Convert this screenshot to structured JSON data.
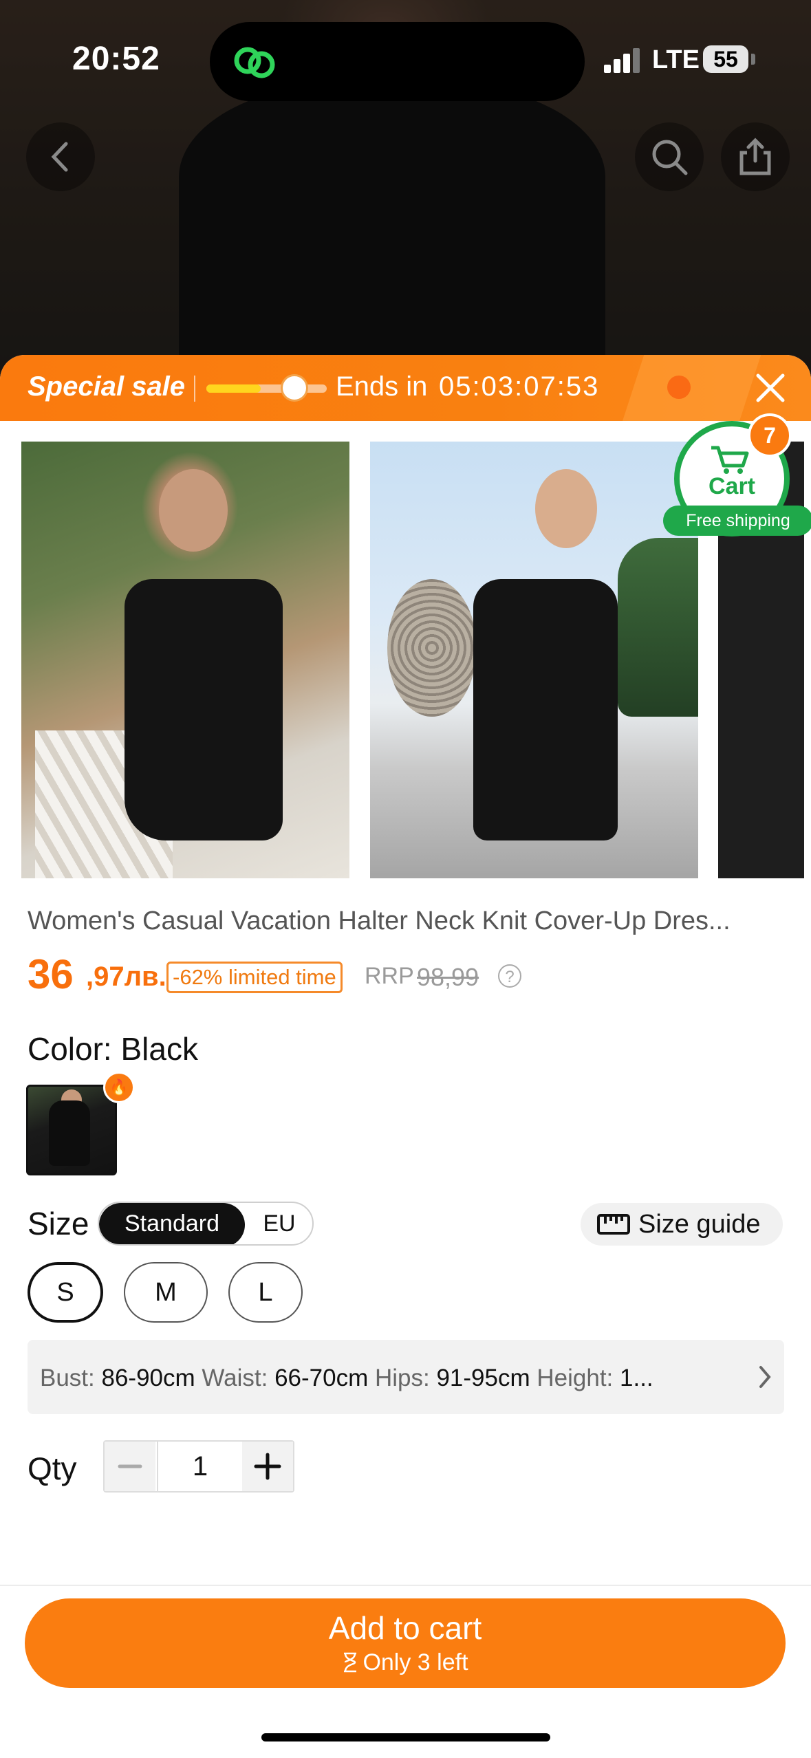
{
  "status": {
    "time": "20:52",
    "network": "LTE",
    "battery": "55"
  },
  "sale": {
    "title": "Special sale",
    "ends_label": "Ends in",
    "countdown": "05:03:07:53",
    "progress": 0.45
  },
  "cart": {
    "label": "Cart",
    "badge": "7",
    "free_shipping": "Free shipping"
  },
  "product": {
    "title": "Women's Casual Vacation Halter Neck Knit Cover-Up Dres...",
    "price_int": "36",
    "price_dec": ",97лв.",
    "discount": "-62% limited time",
    "rrp_label": "RRP",
    "rrp_price": "98,99",
    "help": "?"
  },
  "color": {
    "label": "Color: Black"
  },
  "size": {
    "label": "Size",
    "standard": "Standard",
    "eu": "EU",
    "guide": "Size guide",
    "options": [
      "S",
      "M",
      "L"
    ],
    "selected": "S"
  },
  "measurements": {
    "bust_label": "Bust:",
    "bust": "86-90cm",
    "waist_label": "Waist:",
    "waist": "66-70cm",
    "hips_label": "Hips:",
    "hips": "91-95cm",
    "height_label": "Height:",
    "height": "1..."
  },
  "qty": {
    "label": "Qty",
    "value": "1",
    "minus": "−",
    "plus": "+"
  },
  "cta": {
    "main": "Add to cart",
    "sub": "Only 3 left"
  },
  "icons": {
    "back": "chevron-left-icon",
    "search": "search-icon",
    "share": "share-icon",
    "close": "close-icon",
    "cart": "cart-icon",
    "ruler": "ruler-icon",
    "hourglass": "hourglass-icon",
    "fire": "fire-icon",
    "chevron_right": "chevron-right-icon"
  },
  "colors": {
    "accent": "#fa7d10",
    "green": "#1fa84a"
  }
}
